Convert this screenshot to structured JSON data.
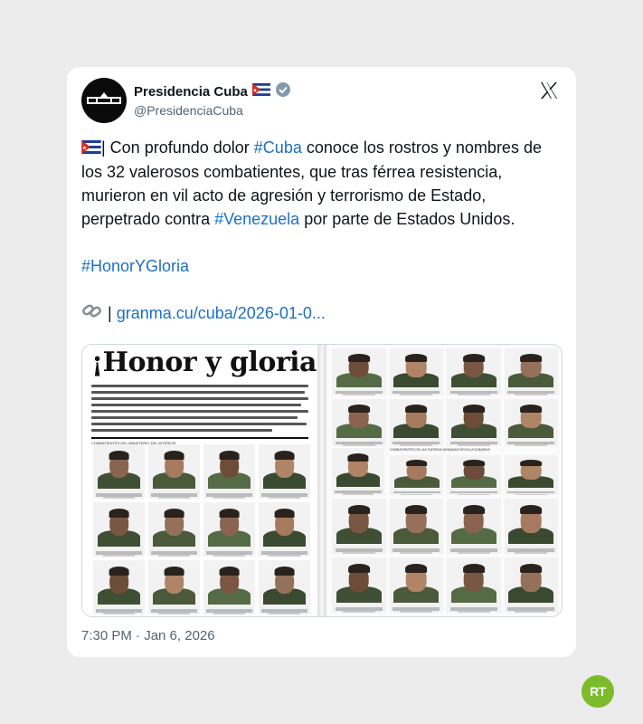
{
  "author": {
    "display_name": "Presidencia Cuba",
    "handle": "@PresidenciaCuba"
  },
  "tweet": {
    "line1_pre": "| Con profundo dolor ",
    "hashtag_cuba": "#Cuba",
    "line1_post": " conoce los rostros y nombres de los 32 valerosos combatientes, que tras férrea resistencia, murieron en vil acto de agresión y terrorismo de Estado, perpetrado contra ",
    "hashtag_venezuela": "#Venezuela",
    "line1_end": " por parte de Estados Unidos.",
    "hashtag_honor": "#HonorYGloria",
    "link_prefix": "| ",
    "link_text": "granma.cu/cuba/2026-01-0..."
  },
  "media": {
    "headline": "¡Honor y gloria!",
    "left_section_label": "COMBATIENTES DEL MINISTERIO DEL INTERIOR",
    "right_section_label": "COMBATIENTES DE LAS FUERZAS ARMADAS REVOLUCIONARIAS"
  },
  "timestamp": "7:30 PM · Jan 6, 2026",
  "watermark": "RT",
  "colors": {
    "link": "#1d6fc8",
    "verified": "#829aab",
    "rt_green": "#7dbb2c"
  }
}
